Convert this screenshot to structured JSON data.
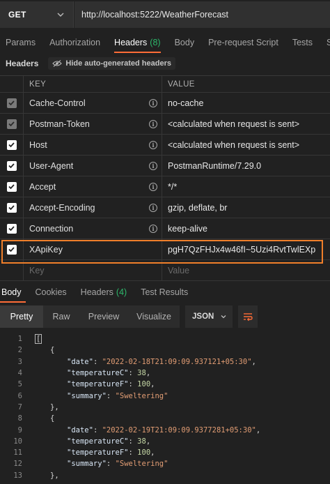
{
  "request": {
    "method": "GET",
    "url": "http://localhost:5222/WeatherForecast"
  },
  "request_tabs": [
    {
      "label": "Params"
    },
    {
      "label": "Authorization"
    },
    {
      "label": "Headers",
      "count": "(8)"
    },
    {
      "label": "Body"
    },
    {
      "label": "Pre-request Script"
    },
    {
      "label": "Tests"
    },
    {
      "label": "Se"
    }
  ],
  "headers_bar": {
    "title": "Headers",
    "hide_auto_label": "Hide auto-generated headers"
  },
  "table": {
    "key_header": "KEY",
    "value_header": "VALUE",
    "rows": [
      {
        "key": "Cache-Control",
        "value": "no-cache",
        "state": "dim"
      },
      {
        "key": "Postman-Token",
        "value": "<calculated when request is sent>",
        "state": "dim"
      },
      {
        "key": "Host",
        "value": "<calculated when request is sent>",
        "state": "on"
      },
      {
        "key": "User-Agent",
        "value": "PostmanRuntime/7.29.0",
        "state": "on"
      },
      {
        "key": "Accept",
        "value": "*/*",
        "state": "on"
      },
      {
        "key": "Accept-Encoding",
        "value": "gzip, deflate, br",
        "state": "on"
      },
      {
        "key": "Connection",
        "value": "keep-alive",
        "state": "on"
      },
      {
        "key": "XApiKey",
        "value": "pgH7QzFHJx4w46fI~5Uzi4RvtTwlEXp",
        "state": "on"
      }
    ],
    "placeholder_key": "Key",
    "placeholder_value": "Value"
  },
  "response_tabs": [
    {
      "label": "Body"
    },
    {
      "label": "Cookies"
    },
    {
      "label": "Headers",
      "count": "(4)"
    },
    {
      "label": "Test Results"
    }
  ],
  "response_toolbar": {
    "views": [
      "Pretty",
      "Raw",
      "Preview",
      "Visualize"
    ],
    "format": "JSON"
  },
  "code": {
    "line_numbers": [
      "1",
      "2",
      "3",
      "4",
      "5",
      "6",
      "7",
      "8",
      "9",
      "10",
      "11",
      "12",
      "13"
    ],
    "entries": [
      {
        "date": "\"2022-02-18T21:09:09.937121+05:30\"",
        "temperatureC": "38",
        "temperatureF": "100",
        "summary": "\"Sweltering\""
      },
      {
        "date": "\"2022-02-19T21:09:09.9377281+05:30\"",
        "temperatureC": "38",
        "temperatureF": "100",
        "summary": "\"Sweltering\""
      }
    ],
    "keys": {
      "date": "\"date\"",
      "temperatureC": "\"temperatureC\"",
      "temperatureF": "\"temperatureF\"",
      "summary": "\"summary\""
    }
  },
  "colors": {
    "accent": "#ff6c37",
    "count_green": "#2db86b",
    "highlight": "#f07f2a"
  }
}
